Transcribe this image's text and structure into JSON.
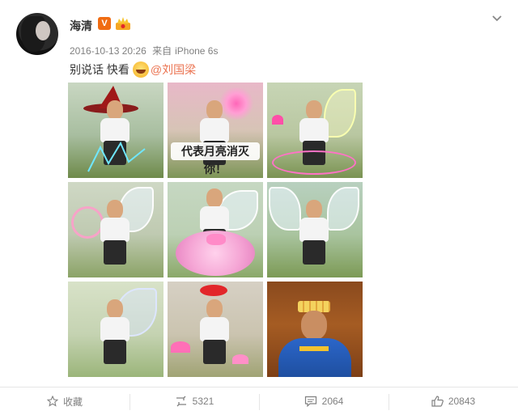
{
  "post": {
    "user_name": "海清",
    "verified_badge": "V",
    "date": "2016-10-13 20:26",
    "source_prefix": "来自",
    "source_device": "iPhone 6s",
    "text": "别说话 快看",
    "mention": "@刘国梁"
  },
  "images": [
    {
      "caption": ""
    },
    {
      "caption": "代表月亮消灭你！"
    },
    {
      "caption": ""
    },
    {
      "caption": ""
    },
    {
      "caption": ""
    },
    {
      "caption": ""
    },
    {
      "caption": ""
    },
    {
      "caption": ""
    },
    {
      "caption": ""
    }
  ],
  "actions": {
    "favorite_label": "收藏",
    "repost_count": "5321",
    "comment_count": "2064",
    "like_count": "20843"
  },
  "icons": {
    "verified": "verified-v-icon",
    "member": "crown-icon",
    "menu": "chevron-down-icon",
    "favorite": "star-icon",
    "repost": "repost-icon",
    "comment": "comment-icon",
    "like": "thumbs-up-icon"
  },
  "colors": {
    "mention": "#eb7350",
    "verified": "#f06c12",
    "meta": "#808080"
  }
}
